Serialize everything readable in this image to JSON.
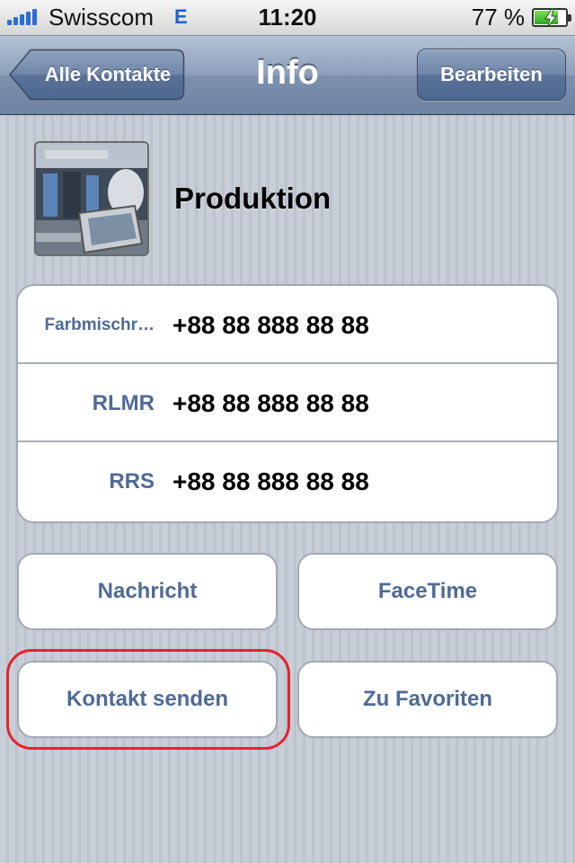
{
  "status_bar": {
    "carrier": "Swisscom",
    "network": "E",
    "time": "11:20",
    "battery_percent": "77 %",
    "battery_level": 0.77,
    "signal_bars": 5,
    "icons": [
      "signal-bars-icon",
      "battery-charging-icon"
    ]
  },
  "nav": {
    "back_label": "Alle Kontakte",
    "title": "Info",
    "edit_label": "Bearbeiten"
  },
  "contact": {
    "name": "Produktion",
    "photo": "contact-photo"
  },
  "phones": [
    {
      "label": "Farbmischr…",
      "value": "+88 88 888 88 88"
    },
    {
      "label": "RLMR",
      "value": "+88 88 888 88 88"
    },
    {
      "label": "RRS",
      "value": "+88 88 888 88 88"
    }
  ],
  "actions": {
    "message": "Nachricht",
    "facetime": "FaceTime",
    "share_contact": "Kontakt senden",
    "add_favorite": "Zu Favoriten"
  },
  "colors": {
    "accent_text": "#4f6a97",
    "highlight": "#e4242a",
    "nav_bar": "#7d91ae"
  }
}
